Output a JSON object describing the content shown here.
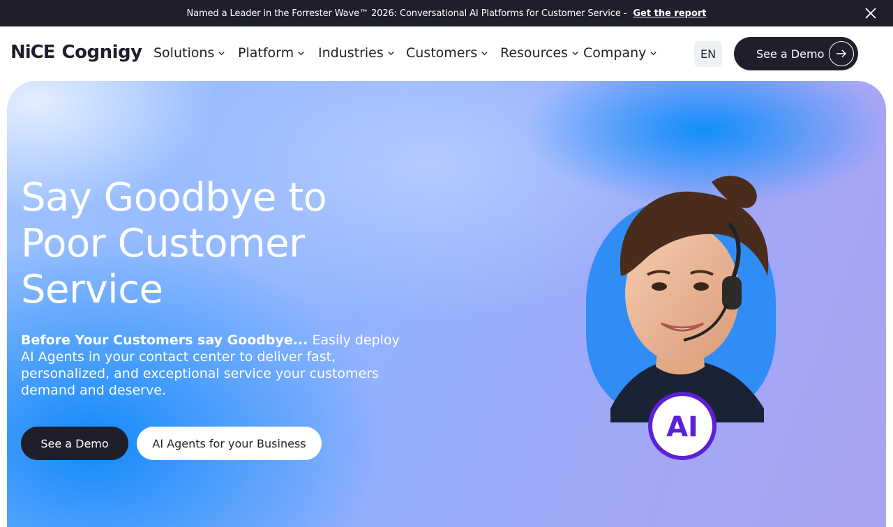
{
  "announcement": {
    "text": "Named a Leader in the Forrester Wave™ 2026: Conversational AI Platforms for Customer Service -",
    "link_label": "Get the report",
    "close_icon": "close-icon"
  },
  "header": {
    "logo": {
      "part1": "NiCE",
      "part2": "Cognigy"
    },
    "nav": [
      {
        "label": "Solutions"
      },
      {
        "label": "Platform"
      },
      {
        "label": "Industries"
      },
      {
        "label": "Customers"
      },
      {
        "label": "Resources"
      },
      {
        "label": "Company"
      }
    ],
    "language": "EN",
    "demo_button": "See a Demo"
  },
  "hero": {
    "headline": "Say Goodbye to Poor Customer Service",
    "lead_bold": "Before Your Customers say Goodbye...",
    "lead_rest": " Easily deploy AI Agents in your contact center to deliver fast, personalized, and exceptional service your customers demand and deserve.",
    "primary_button": "See a Demo",
    "secondary_button": "AI Agents for your Business",
    "badge_text": "AI"
  },
  "colors": {
    "dark": "#1e1f2b",
    "brand_purple": "#5b21d6",
    "accent_blue": "#2f8df5"
  }
}
